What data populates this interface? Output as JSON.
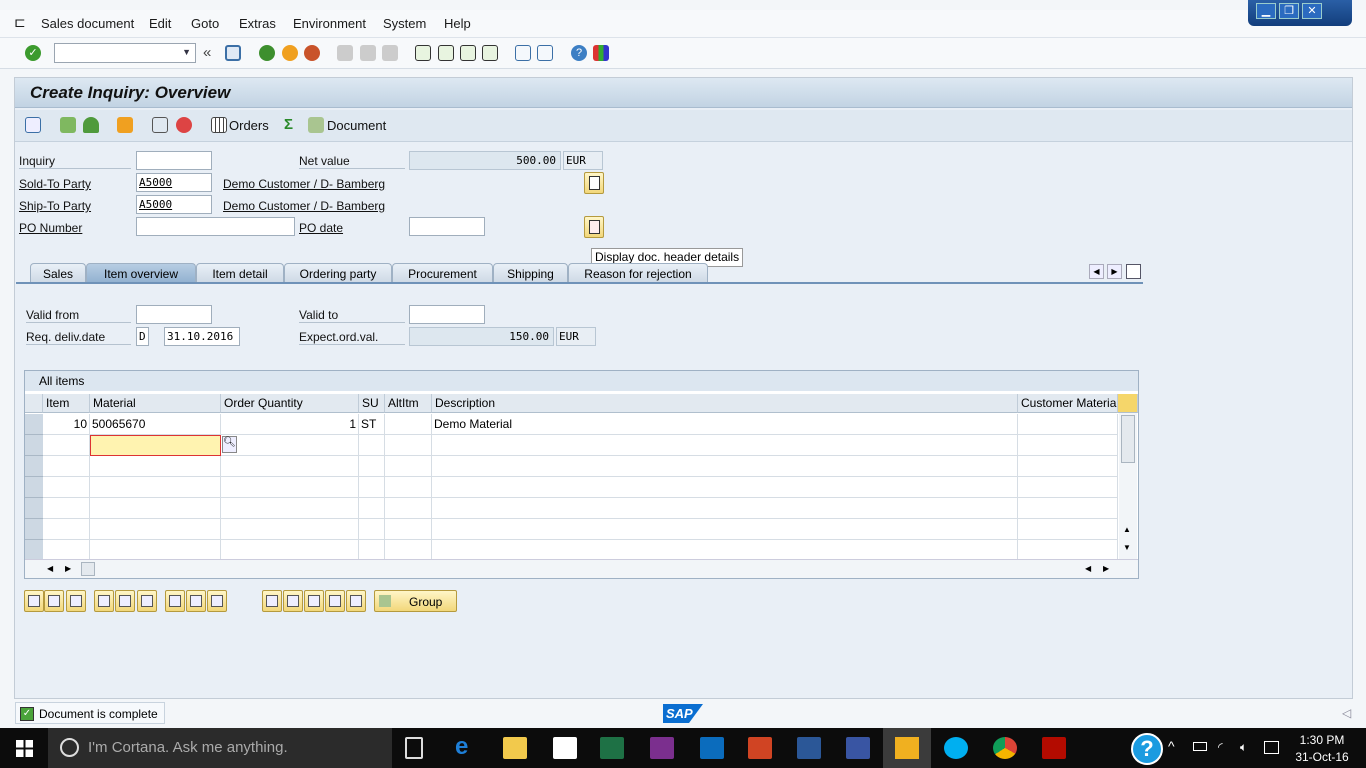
{
  "menu": {
    "items": [
      "Sales document",
      "Edit",
      "Goto",
      "Extras",
      "Environment",
      "System",
      "Help"
    ]
  },
  "window_controls": [
    "minimize",
    "restore",
    "close"
  ],
  "toolbar": {
    "command_field": "",
    "icons": [
      "enter-icon",
      "back-double-icon",
      "save-icon",
      "back-icon",
      "exit-icon",
      "cancel-icon",
      "print-icon",
      "find-icon",
      "find-next-icon",
      "first-page-icon",
      "previous-page-icon",
      "next-page-icon",
      "last-page-icon",
      "new-session-icon",
      "shortcut-icon",
      "help-icon",
      "customize-icon"
    ]
  },
  "title": "Create Inquiry: Overview",
  "app_toolbar": {
    "orders_label": "Orders",
    "document_label": "Document"
  },
  "header": {
    "inquiry_label": "Inquiry",
    "inquiry_value": "",
    "net_value_label": "Net value",
    "net_value": "500.00",
    "net_currency": "EUR",
    "sold_to_label": "Sold-To Party",
    "sold_to_value": "A5000",
    "sold_to_name": "Demo Customer / D- Bamberg",
    "ship_to_label": "Ship-To Party",
    "ship_to_value": "A5000",
    "ship_to_name": "Demo Customer / D- Bamberg",
    "po_number_label": "PO Number",
    "po_number_value": "",
    "po_date_label": "PO date",
    "po_date_value": ""
  },
  "tooltip": "Display doc. header details",
  "tabs": [
    {
      "label": "Sales"
    },
    {
      "label": "Item overview",
      "active": true
    },
    {
      "label": "Item detail"
    },
    {
      "label": "Ordering party"
    },
    {
      "label": "Procurement"
    },
    {
      "label": "Shipping"
    },
    {
      "label": "Reason for rejection"
    }
  ],
  "item_overview": {
    "valid_from_label": "Valid from",
    "valid_from": "",
    "valid_to_label": "Valid to",
    "valid_to": "",
    "req_deliv_label": "Req. deliv.date",
    "req_deliv_type": "D",
    "req_deliv_date": "31.10.2016",
    "expect_label": "Expect.ord.val.",
    "expect_value": "150.00",
    "expect_currency": "EUR"
  },
  "table": {
    "title": "All items",
    "columns": [
      "Item",
      "Material",
      "Order Quantity",
      "SU",
      "AltItm",
      "Description",
      "Customer Material"
    ],
    "rows": [
      [
        "10",
        "50065670",
        "1",
        "ST",
        "",
        "Demo Material",
        ""
      ]
    ]
  },
  "bottom_buttons": {
    "group_label": "Group"
  },
  "status": {
    "text": "Document is complete"
  },
  "taskbar": {
    "cortana": "I'm Cortana. Ask me anything.",
    "time": "1:30 PM",
    "date": "31-Oct-16"
  },
  "colors": {
    "sap_blue": "#0a6ed1",
    "field_highlight": "#fff3b0"
  }
}
